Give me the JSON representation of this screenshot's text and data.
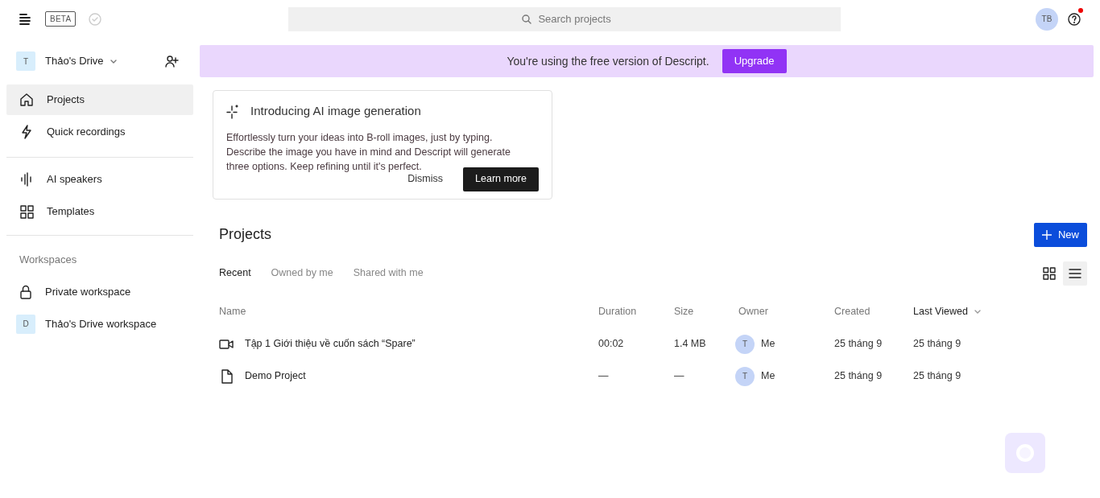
{
  "header": {
    "badge": "BETA",
    "search": {
      "placeholder": "Search projects"
    },
    "avatar": "TB",
    "help_notification": true
  },
  "sidebar": {
    "drive": {
      "initial": "T",
      "name": "Thảo's Drive"
    },
    "nav": [
      {
        "label": "Projects",
        "kind": "home",
        "selected": true
      },
      {
        "label": "Quick recordings",
        "kind": "bolt",
        "selected": false
      }
    ],
    "tools": [
      {
        "label": "AI speakers",
        "kind": "wave",
        "selected": false
      },
      {
        "label": "Templates",
        "kind": "grid",
        "selected": false
      }
    ],
    "workspaces_heading": "Workspaces",
    "workspaces": [
      {
        "label": "Private workspace",
        "kind": "lock"
      },
      {
        "label": "Thảo's Drive workspace",
        "kind": "initial",
        "initial": "D"
      }
    ]
  },
  "banner": {
    "text": "You're using the free version of Descript.",
    "button": "Upgrade"
  },
  "promo": {
    "title": "Introducing AI image generation",
    "body": "Effortlessly turn your ideas into B-roll images, just by typing. Describe the image you have in mind and Descript will generate three options. Keep refining until it's perfect.",
    "dismiss": "Dismiss",
    "action": "Learn more"
  },
  "projects": {
    "title": "Projects",
    "new_button": "New",
    "tabs": [
      {
        "label": "Recent",
        "selected": true
      },
      {
        "label": "Owned by me",
        "selected": false
      },
      {
        "label": "Shared with me",
        "selected": false
      }
    ],
    "views": [
      {
        "kind": "grid",
        "selected": false
      },
      {
        "kind": "list",
        "selected": true
      }
    ],
    "columns": [
      {
        "label": "Name",
        "sorted": false
      },
      {
        "label": "Duration",
        "sorted": false
      },
      {
        "label": "Size",
        "sorted": false
      },
      {
        "label": "Owner",
        "sorted": false
      },
      {
        "label": "Created",
        "sorted": false
      },
      {
        "label": "Last Viewed",
        "sorted": true
      }
    ],
    "rows": [
      {
        "kind": "video",
        "name": "Tập 1 Giới thiệu về cuốn sách “Spare”",
        "duration": "00:02",
        "size": "1.4 MB",
        "owner_initial": "T",
        "owner": "Me",
        "created": "25 tháng 9",
        "last_viewed": "25 tháng 9"
      },
      {
        "kind": "document",
        "name": "Demo Project",
        "duration": "—",
        "size": "—",
        "owner_initial": "T",
        "owner": "Me",
        "created": "25 tháng 9",
        "last_viewed": "25 tháng 9"
      }
    ]
  }
}
